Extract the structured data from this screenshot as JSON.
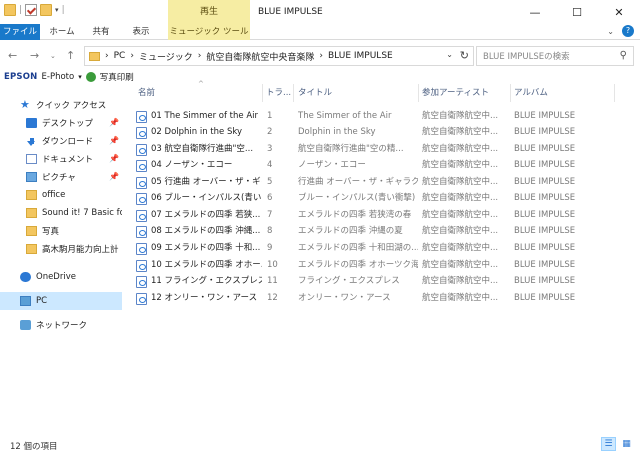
{
  "window": {
    "title": "BLUE IMPULSE",
    "context_tab": "再生",
    "buttons": [
      "—",
      "☐",
      "✕"
    ]
  },
  "ribbon": {
    "tabs": [
      "ファイル",
      "ホーム",
      "共有",
      "表示",
      "ミュージック ツール"
    ]
  },
  "address": {
    "path": [
      "PC",
      "ミュージック",
      "航空自衛隊航空中央音楽隊",
      "BLUE IMPULSE"
    ],
    "search_placeholder": "BLUE IMPULSEの検索"
  },
  "epson": {
    "brand": "EPSON",
    "app": "E-Photo",
    "print": "写真印刷"
  },
  "sidebar": {
    "quick_access": "クイック アクセス",
    "items": [
      {
        "label": "デスクトップ",
        "icon": "desktop-icon",
        "pinned": true
      },
      {
        "label": "ダウンロード",
        "icon": "download-icon",
        "pinned": true
      },
      {
        "label": "ドキュメント",
        "icon": "document-icon",
        "pinned": true
      },
      {
        "label": "ピクチャ",
        "icon": "picture-icon",
        "pinned": true
      },
      {
        "label": "office",
        "icon": "folder-icon",
        "pinned": false
      },
      {
        "label": "Sound it! 7 Basic for",
        "icon": "folder-icon",
        "pinned": false
      },
      {
        "label": "写真",
        "icon": "folder-icon",
        "pinned": false
      },
      {
        "label": "高木駒月能力向上計",
        "icon": "folder-icon",
        "pinned": false
      }
    ],
    "onedrive": "OneDrive",
    "pc": "PC",
    "network": "ネットワーク"
  },
  "columns": {
    "name": "名前",
    "track": "トラ...",
    "title": "タイトル",
    "artist": "参加アーティスト",
    "album": "アルバム"
  },
  "files": [
    {
      "name": "01 The Simmer of the Air",
      "num": "1",
      "title": "The Simmer of the Air",
      "artist": "航空自衛隊航空中...",
      "album": "BLUE IMPULSE"
    },
    {
      "name": "02 Dolphin in the Sky",
      "num": "2",
      "title": "Dolphin in the Sky",
      "artist": "航空自衛隊航空中...",
      "album": "BLUE IMPULSE"
    },
    {
      "name": "03 航空自衛隊行進曲\"空...",
      "num": "3",
      "title": "航空自衛隊行進曲\"空の精...",
      "artist": "航空自衛隊航空中...",
      "album": "BLUE IMPULSE"
    },
    {
      "name": "04 ノーザン・エコー",
      "num": "4",
      "title": "ノーザン・エコー",
      "artist": "航空自衛隊航空中...",
      "album": "BLUE IMPULSE"
    },
    {
      "name": "05 行進曲 オーバー・ザ・ギャ...",
      "num": "5",
      "title": "行進曲 オーバー・ザ・ギャラク...",
      "artist": "航空自衛隊航空中...",
      "album": "BLUE IMPULSE"
    },
    {
      "name": "06 ブルー・インパルス(青い...",
      "num": "6",
      "title": "ブルー・インパルス(青い衝撃)",
      "artist": "航空自衛隊航空中...",
      "album": "BLUE IMPULSE"
    },
    {
      "name": "07 エメラルドの四季 若狭...",
      "num": "7",
      "title": "エメラルドの四季 若狭湾の春",
      "artist": "航空自衛隊航空中...",
      "album": "BLUE IMPULSE"
    },
    {
      "name": "08 エメラルドの四季 沖縄...",
      "num": "8",
      "title": "エメラルドの四季 沖縄の夏",
      "artist": "航空自衛隊航空中...",
      "album": "BLUE IMPULSE"
    },
    {
      "name": "09 エメラルドの四季 十和...",
      "num": "9",
      "title": "エメラルドの四季 十和田湖の...",
      "artist": "航空自衛隊航空中...",
      "album": "BLUE IMPULSE"
    },
    {
      "name": "10 エメラルドの四季 オホー...",
      "num": "10",
      "title": "エメラルドの四季 オホーツク海...",
      "artist": "航空自衛隊航空中...",
      "album": "BLUE IMPULSE"
    },
    {
      "name": "11 フライング・エクスプレス",
      "num": "11",
      "title": "フライング・エクスプレス",
      "artist": "航空自衛隊航空中...",
      "album": "BLUE IMPULSE"
    },
    {
      "name": "12 オンリー・ワン・アース",
      "num": "12",
      "title": "オンリー・ワン・アース",
      "artist": "航空自衛隊航空中...",
      "album": "BLUE IMPULSE"
    }
  ],
  "status": {
    "count": "12 個の項目"
  }
}
